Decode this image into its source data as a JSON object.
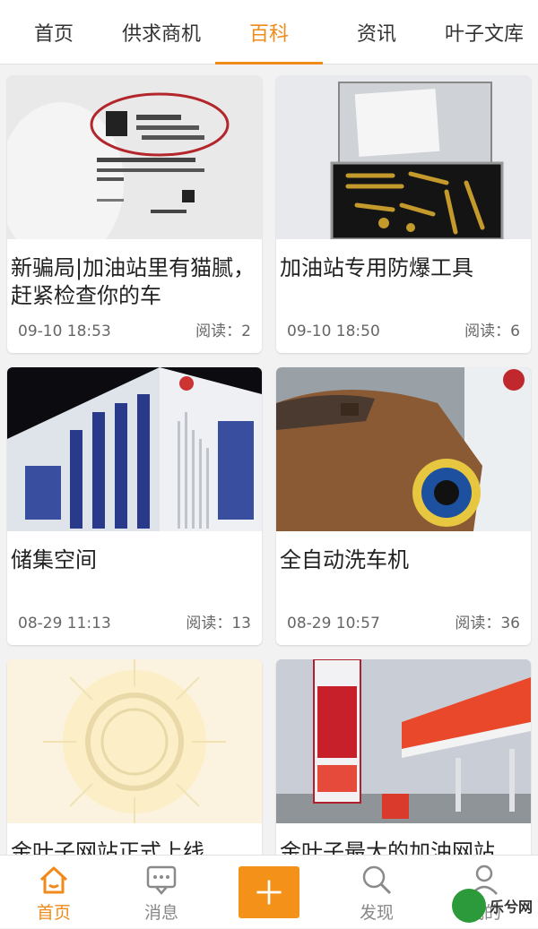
{
  "top_tabs": [
    {
      "label": "首页"
    },
    {
      "label": "供求商机"
    },
    {
      "label": "百科"
    },
    {
      "label": "资讯"
    },
    {
      "label": "叶子文库"
    }
  ],
  "active_top_tab": "百科",
  "cards": [
    {
      "title": "新骗局|加油站里有猫腻，赶紧检查你的车",
      "date": "09-10 18:53",
      "reads": "阅读：2"
    },
    {
      "title": "加油站专用防爆工具",
      "date": "09-10 18:50",
      "reads": "阅读：6"
    },
    {
      "title": "储集空间",
      "date": "08-29 11:13",
      "reads": "阅读：13"
    },
    {
      "title": "全自动洗车机",
      "date": "08-29 10:57",
      "reads": "阅读：36"
    },
    {
      "title": "金叶子网站正式上线",
      "date": "",
      "reads": ""
    },
    {
      "title": "金叶子最大的加油网站",
      "date": "",
      "reads": ""
    }
  ],
  "bottom_nav": [
    {
      "label": "首页",
      "icon": "home-icon"
    },
    {
      "label": "消息",
      "icon": "message-icon"
    },
    {
      "label": "",
      "icon": "plus-icon"
    },
    {
      "label": "发现",
      "icon": "search-icon"
    },
    {
      "label": "我的",
      "icon": "user-icon"
    }
  ],
  "watermark": "乐兮网",
  "colors": {
    "accent": "#f08a1b",
    "plus_bg": "#f39119"
  }
}
